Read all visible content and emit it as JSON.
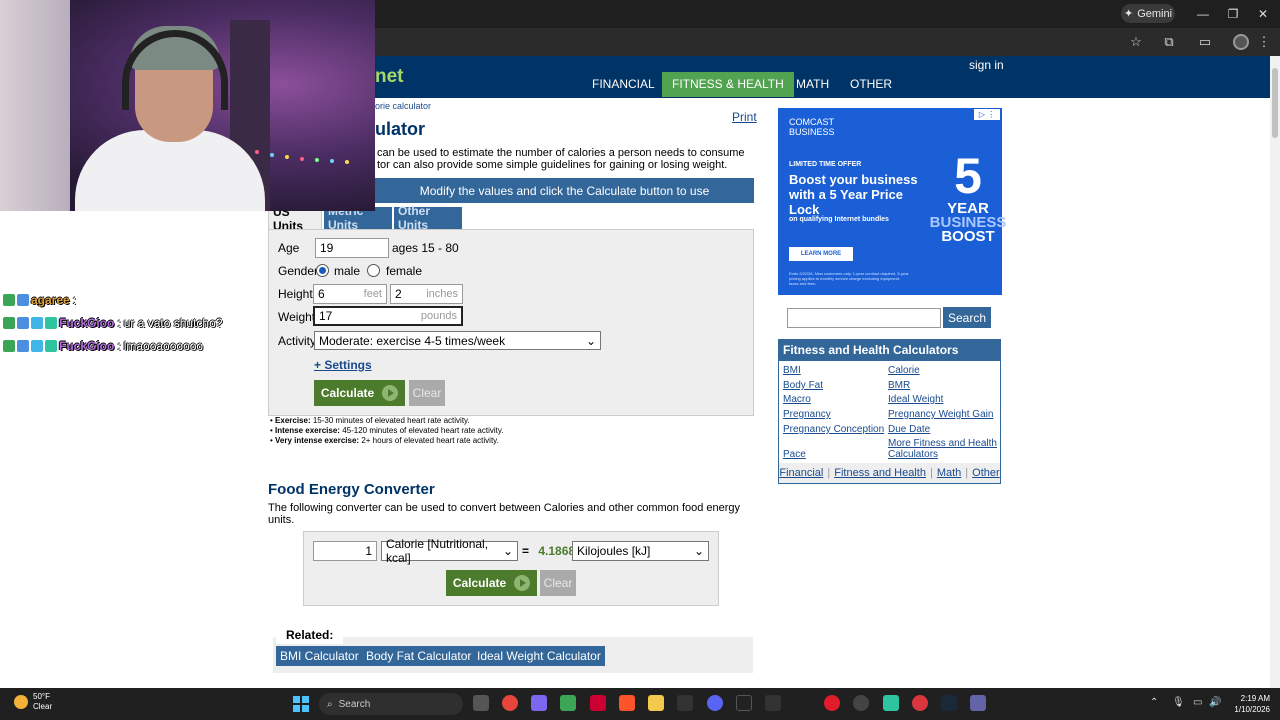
{
  "browser": {
    "gemini_label": "Gemini",
    "min_icon": "minimize-icon",
    "restore_icon": "restore-icon",
    "close_icon": "close-icon"
  },
  "site": {
    "logo_partial": "net",
    "signin": "sign in",
    "nav": [
      "FINANCIAL",
      "FITNESS & HEALTH",
      "MATH",
      "OTHER"
    ],
    "active_nav": "FITNESS & HEALTH",
    "breadcrumb": "orie calculator",
    "title_partial": "ulator",
    "print": "Print",
    "intro_line1": "can be used to estimate the number of calories a person needs to consume",
    "intro_line2": "tor can also provide some simple guidelines for gaining or losing weight.",
    "bar_text": "Modify the values and click the Calculate button to use"
  },
  "tabs": [
    "US Units",
    "Metric Units",
    "Other Units"
  ],
  "form": {
    "age_label": "Age",
    "age_value": "19",
    "age_hint": "ages 15 - 80",
    "gender_label": "Gender",
    "gender_male": "male",
    "gender_female": "female",
    "gender_selected": "male",
    "height_label": "Height",
    "height_feet": "6",
    "height_feet_unit": "feet",
    "height_inches": "2",
    "height_inches_unit": "inches",
    "weight_label": "Weight",
    "weight_value": "17",
    "weight_unit": "pounds",
    "activity_label": "Activity",
    "activity_value": "Moderate: exercise 4-5 times/week",
    "settings": "+ Settings",
    "calculate": "Calculate",
    "clear": "Clear"
  },
  "notes": [
    {
      "term": "Exercise:",
      "text": "15-30 minutes of elevated heart rate activity."
    },
    {
      "term": "Intense exercise:",
      "text": "45-120 minutes of elevated heart rate activity."
    },
    {
      "term": "Very intense exercise:",
      "text": "2+ hours of elevated heart rate activity."
    }
  ],
  "converter": {
    "title": "Food Energy Converter",
    "desc": "The following converter can be used to convert between Calories and other common food energy units.",
    "input_value": "1",
    "from_unit": "Calorie [Nutritional, kcal]",
    "equals": "=",
    "result": "4.1868",
    "to_unit": "Kilojoules [kJ]",
    "calculate": "Calculate",
    "clear": "Clear"
  },
  "related": {
    "label": "Related:",
    "links": [
      "BMI Calculator",
      "Body Fat Calculator",
      "Ideal Weight Calculator"
    ]
  },
  "ad": {
    "brand1": "COMCAST",
    "brand2": "BUSINESS",
    "ltd": "LIMITED TIME OFFER",
    "headline": "Boost your business with a 5 Year Price Lock",
    "sub": "on qualifying Internet bundles",
    "learn": "LEARN MORE",
    "fine": "Ends 2/22/26. New customers only. 1-year contract required. 5-year pricing applies to monthly service charge excluding equipment, taxes and fees.",
    "five": "5",
    "year1": "YEAR",
    "year2": "BUSINESS",
    "year3": "BOOST"
  },
  "sidebar": {
    "search_button": "Search",
    "box_title": "Fitness and Health Calculators",
    "links_left": [
      "BMI",
      "Body Fat",
      "Macro",
      "Pregnancy",
      "Pregnancy Conception",
      "Pace"
    ],
    "links_right": [
      "Calorie",
      "BMR",
      "Ideal Weight",
      "Pregnancy Weight Gain",
      "Due Date",
      "More Fitness and Health Calculators"
    ],
    "footer": [
      "Financial",
      "Fitness and Health",
      "Math",
      "Other"
    ]
  },
  "chat": [
    {
      "user": "agaree",
      "sep": ":",
      "msg": "",
      "color": "#e0a33b"
    },
    {
      "user": "FuckGioo",
      "sep": ":",
      "msg": "ur a vato shutcho?",
      "color": "#b26be0"
    },
    {
      "user": "FuckGioo",
      "sep": ":",
      "msg": "lmaooaoooooo",
      "color": "#b26be0"
    }
  ],
  "taskbar": {
    "temp": "50°F",
    "condition": "Clear",
    "search": "Search",
    "time": "2:19 AM",
    "date": "1/10/2026"
  }
}
